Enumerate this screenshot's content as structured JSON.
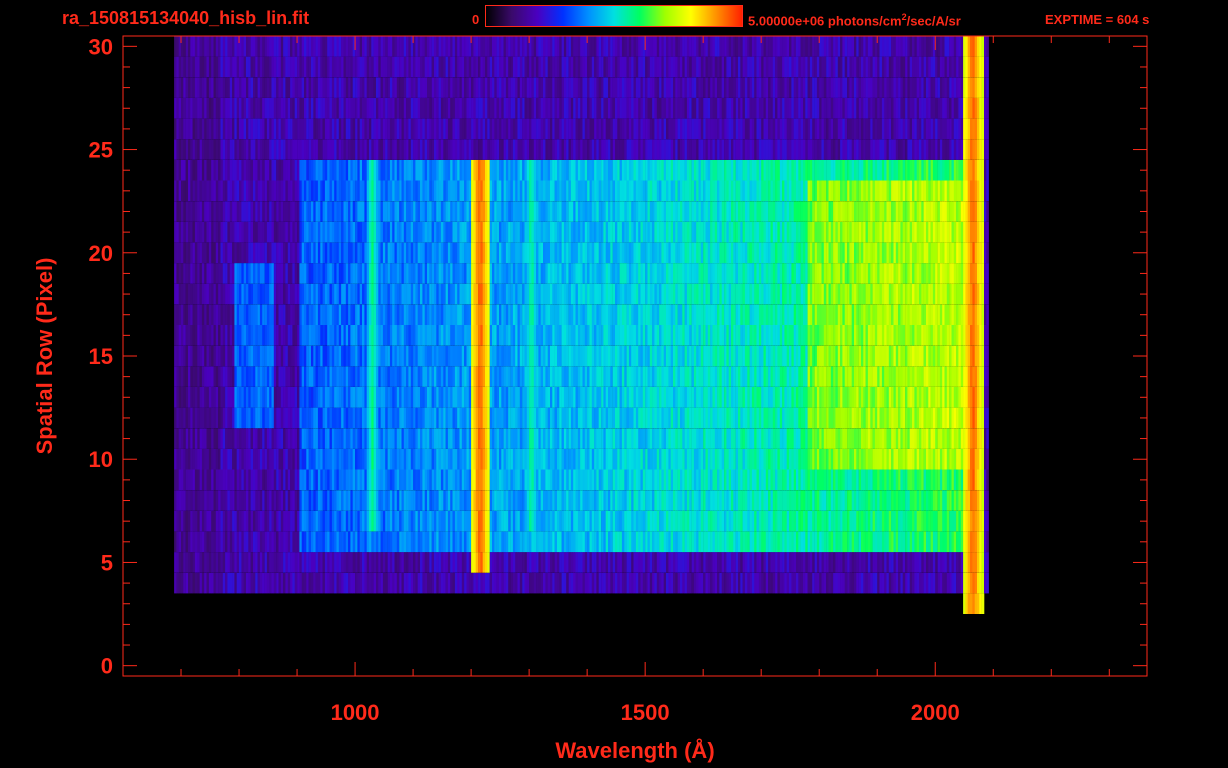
{
  "header": {
    "file_title": "ra_150815134040_hisb_lin.fit",
    "colorbar_min": "0",
    "colorbar_max_value": "5.00000e+06 photons/cm",
    "colorbar_max_sup": "2",
    "colorbar_max_unit": "/sec/A/sr",
    "exptime": "EXPTIME = 604 s"
  },
  "colors": {
    "axis": "#ff2a1a",
    "background": "#000000",
    "colormap": [
      "#000000",
      "#3a0a6a",
      "#4a00c0",
      "#0030ff",
      "#0090ff",
      "#00e0e0",
      "#00ff60",
      "#a0ff00",
      "#ffff00",
      "#ff9000",
      "#ff2000"
    ]
  },
  "chart_data": {
    "type": "heatmap",
    "title": "",
    "xlabel": "Wavelength (Å)",
    "ylabel": "Spatial Row (Pixel)",
    "xlim": [
      600,
      2365
    ],
    "ylim": [
      -0.5,
      30.5
    ],
    "x_ticks": [
      1000,
      1500,
      2000
    ],
    "y_ticks": [
      0,
      5,
      10,
      15,
      20,
      25,
      30
    ],
    "colorbar_range": [
      0,
      5000000
    ],
    "bright_features": [
      {
        "wavelength": 1216,
        "rows": [
          5,
          24
        ],
        "level": "high"
      },
      {
        "wavelength": 1304,
        "rows": [
          7,
          24
        ],
        "level": "medium"
      },
      {
        "wavelength": 1030,
        "rows": [
          7,
          24
        ],
        "level": "medium"
      },
      {
        "wavelength": 2065,
        "rows": [
          3,
          30
        ],
        "level": "high"
      }
    ],
    "signal_region": {
      "x": [
        905,
        2070
      ],
      "rows": [
        6,
        24
      ]
    },
    "background_region": {
      "x": [
        770,
        2090
      ],
      "rows": [
        4,
        30
      ]
    }
  }
}
